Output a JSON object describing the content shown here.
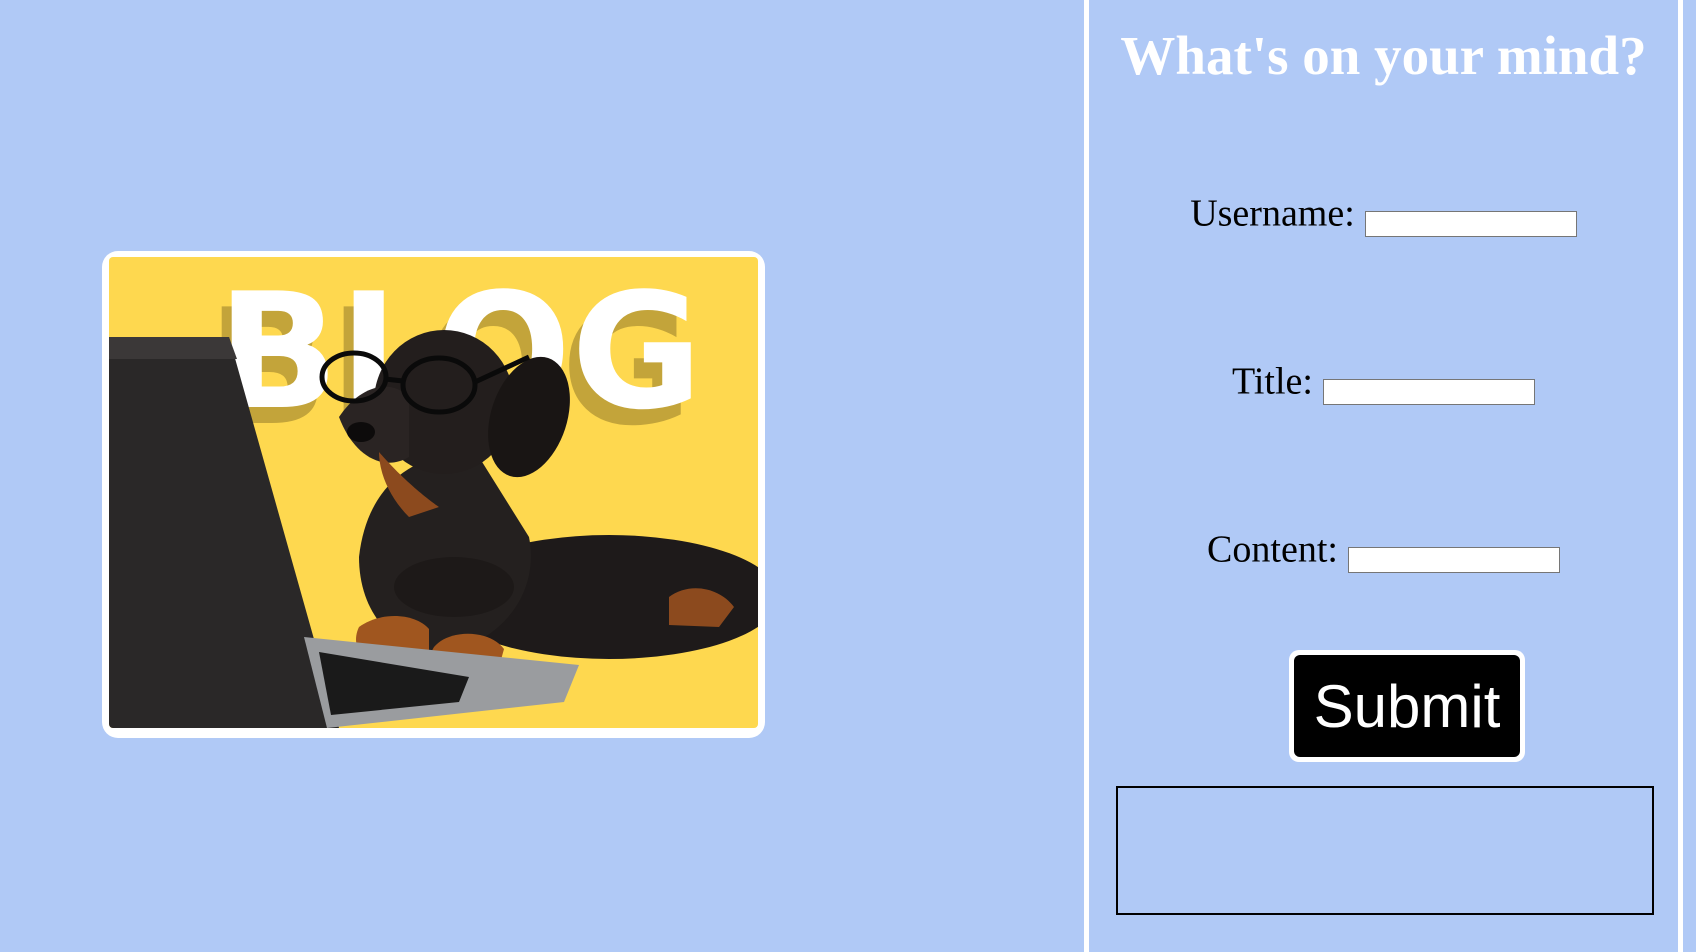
{
  "hero": {
    "image_alt": "Dachshund wearing glasses typing on a laptop",
    "banner_word": "BLOG",
    "colors": {
      "background": "#fed84f",
      "banner_text": "#ffffff",
      "banner_shadow": "#c3a43a"
    }
  },
  "form": {
    "heading": "What's on your mind?",
    "username_label": "Username:",
    "title_label": "Title:",
    "content_label": "Content:",
    "username_value": "",
    "title_value": "",
    "content_value": "",
    "submit_label": "Submit"
  },
  "output": {
    "text": ""
  },
  "colors": {
    "page_background": "#b0c9f6",
    "heading": "#ffffff",
    "button_background": "#000000",
    "button_text": "#ffffff"
  }
}
